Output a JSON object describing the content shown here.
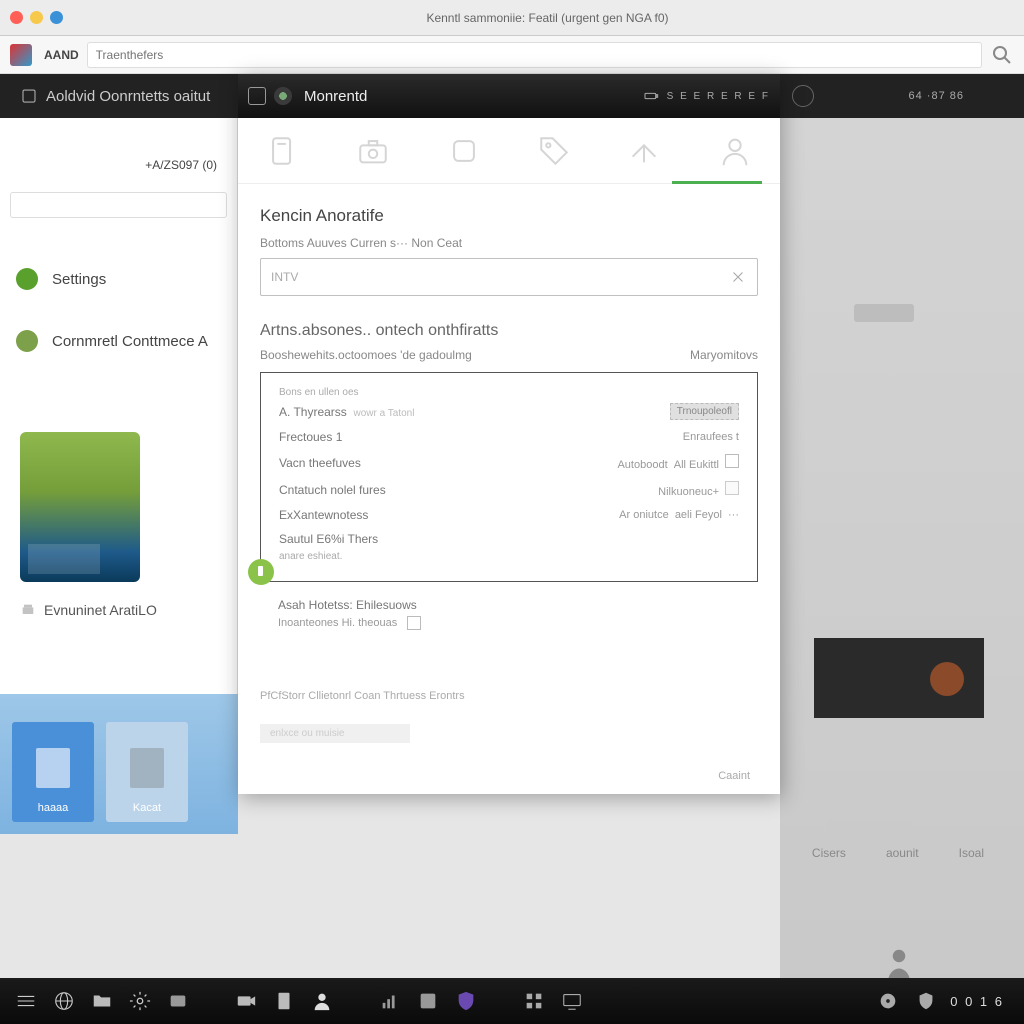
{
  "chrome": {
    "title": "Kenntl sammoniie: Featil (urgent gen NGA f0)"
  },
  "url": {
    "brand": "AAND",
    "placeholder": "Traenthefers"
  },
  "bg": {
    "header": "Aoldvid Oonrntetts oaitut",
    "numbers": "64 ·87 86"
  },
  "sidebar": {
    "tag": "+A/ZS097 (0)",
    "items": [
      {
        "label": "Settings"
      },
      {
        "label": "Cornmretl Conttmece A"
      }
    ],
    "link": "Evnuninet AratiLO"
  },
  "tiles": [
    {
      "label": "haaaa"
    },
    {
      "label": "Kacat"
    }
  ],
  "backdrop": {
    "cols": [
      "Cisers",
      "aounit",
      "Isoal"
    ]
  },
  "modal": {
    "title": "Monrentd",
    "status_right": "S E E R E R E F",
    "section1": {
      "title": "Kencin Anoratife",
      "sub": "Bottoms Auuves Curren s··· Non  Ceat",
      "input": "INTV"
    },
    "section2": {
      "title": "Artns.absones.. ontech onthfiratts",
      "left_sub": "Booshewehits.octoomoes 'de gadoulmg",
      "right_sub": "Maryomitovs"
    },
    "detail": {
      "row0_label": "Bons en ullen oes",
      "row1_l": "A. Thyrearss",
      "row1_sub": "wowr a Tatonl",
      "row2_l": "Frectoues 1",
      "row3_l": "Vacn theefuves",
      "row4_l": "Cntatuch nolel fures",
      "row5_l": "ExXantewnotess",
      "row6_l": "Sautul E6%i Thers",
      "row7_l": "anare eshieat.",
      "right1": "Trnoupoleofl",
      "right2_l": "Enraufees t",
      "right3_l": "Autoboodt",
      "right3_r": "All Eukittl",
      "right4_l": "Nilkuoneuc+",
      "right5_l": "Ar oniutce",
      "right5_r": "aeli Feyol"
    },
    "sub3": {
      "head": "Asah Hotetss: Ehilesuows",
      "row": "Inoanteones Hi. theouas"
    },
    "footer_hint": "PfCfStorr Cllietonrl Coan Thrtuess Erontrs",
    "ghost": "enlxce ou muisie",
    "save": "Caaint"
  },
  "taskbar": {
    "clock": "0 0 1 6"
  }
}
